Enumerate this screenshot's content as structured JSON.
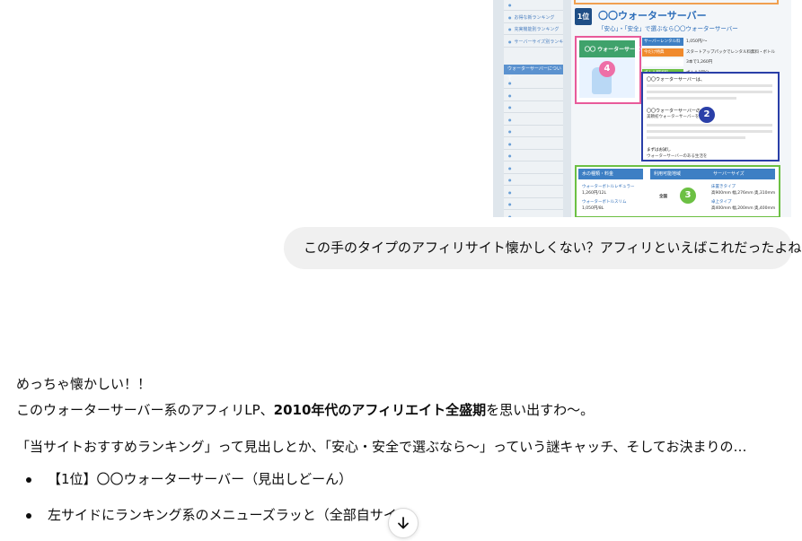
{
  "screenshot": {
    "nav_items_top": [
      "",
      "お得な新ランキング",
      "充実機能別ランキング",
      "サーバーサイズ別ランキング"
    ],
    "nav_heading": "ウォーターサーバーについて",
    "nav_items": [
      "",
      "",
      "",
      "",
      "",
      "",
      "",
      "",
      "",
      "",
      "",
      "",
      "",
      ""
    ],
    "rank_badge": "1位",
    "rank_title": "〇〇ウォーターサーバー",
    "rank_subtitle": "「安心」・「安全」で選ぶなら〇〇ウォーターサーバー",
    "product_label": "〇〇 ウォーターサーバー",
    "spec_rows": [
      {
        "label": "サーバーレンタル料",
        "value": "1,050円/～",
        "color": "#3d7fc4"
      },
      {
        "label": "今だけ特典",
        "value": "スタートアップパックでレンタル料無料・ボトル",
        "color": "#f08a2c"
      },
      {
        "label": "",
        "value": "3本で1,260円",
        "color": "#ffffff"
      },
      {
        "label": "ボトル配送料",
        "value": "ボトル1回分",
        "color": "#6cc043"
      }
    ],
    "desc_lead": "〇〇ウォーターサーバーは、",
    "desc_mid": "〇〇ウォーターサーバーの",
    "desc_mid2": "美頼初ウォーターサーバーを",
    "desc_end": "まずはお試し",
    "desc_end2": "ウォーターサーバーのある生活を",
    "table_headers": [
      "水の種類・料金",
      "利用可能地域",
      "サーバーサイズ"
    ],
    "table_col1": [
      "ウォーターボトルレギュラー",
      "1,260円/12L",
      "ウォーターボトルスリム",
      "1,050円/8L"
    ],
    "table_col2": "全国",
    "table_col3": [
      "床置きタイプ",
      "高900mm 幅,276mm 奥,310mm",
      "卓上タイプ",
      "高400mm 幅,200mm 奥,400mm"
    ],
    "markers": [
      "4",
      "2",
      "3"
    ]
  },
  "user_message": "この手のタイプのアフィリサイト懐かしくない？アフィリといえばこれだったよね。",
  "reply": {
    "p1": "めっちゃ懐かしい！！",
    "p2_before": "このウォーターサーバー系のアフィリLP、",
    "p2_bold": "2010年代のアフィリエイト全盛期",
    "p2_after": "を思い出すわ〜。",
    "p3": "「当サイトおすすめランキング」って見出しとか、「安心・安全で選ぶなら〜」っていう謎キャッチ、そしてお決まりの…",
    "bullets": [
      "【1位】〇〇ウォーターサーバー（見出しどーん）",
      "左サイドにランキング系のメニューズラッと（全部自サイト"
    ]
  },
  "icons": {
    "scroll": "arrow-down-icon"
  }
}
